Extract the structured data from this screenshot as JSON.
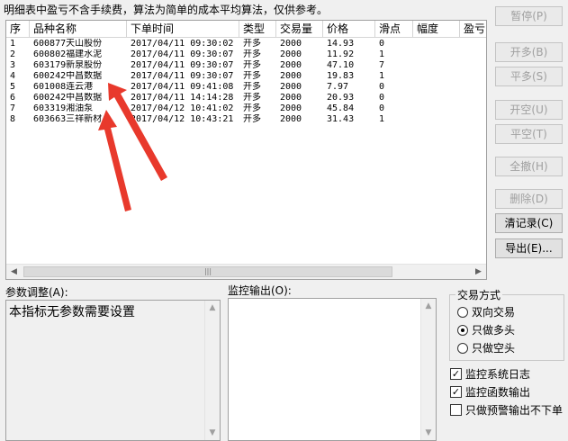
{
  "note": "明细表中盈亏不含手续费，算法为简单的成本平均算法，仅供参考。",
  "table": {
    "columns": [
      "序",
      "品种名称",
      "下单时间",
      "类型",
      "交易量",
      "价格",
      "滑点",
      "幅度",
      "盈亏"
    ],
    "rows": [
      {
        "seq": "1",
        "name": "600877天山股份",
        "time": "2017/04/11  09:30:02",
        "type": "开多",
        "qty": "2000",
        "price": "14.93",
        "slip": "0",
        "amp": "",
        "pnl": ""
      },
      {
        "seq": "2",
        "name": "600802福建水泥",
        "time": "2017/04/11  09:30:07",
        "type": "开多",
        "qty": "2000",
        "price": "11.92",
        "slip": "1",
        "amp": "",
        "pnl": ""
      },
      {
        "seq": "3",
        "name": "603179新泉股份",
        "time": "2017/04/11  09:30:07",
        "type": "开多",
        "qty": "2000",
        "price": "47.10",
        "slip": "7",
        "amp": "",
        "pnl": ""
      },
      {
        "seq": "4",
        "name": "600242中昌数据",
        "time": "2017/04/11  09:30:07",
        "type": "开多",
        "qty": "2000",
        "price": "19.83",
        "slip": "1",
        "amp": "",
        "pnl": ""
      },
      {
        "seq": "5",
        "name": "601008连云港",
        "time": "2017/04/11  09:41:08",
        "type": "开多",
        "qty": "2000",
        "price": "7.97",
        "slip": "0",
        "amp": "",
        "pnl": ""
      },
      {
        "seq": "6",
        "name": "600242中昌数据",
        "time": "2017/04/11  14:14:28",
        "type": "开多",
        "qty": "2000",
        "price": "20.93",
        "slip": "0",
        "amp": "",
        "pnl": ""
      },
      {
        "seq": "7",
        "name": "603319湘油泵",
        "time": "2017/04/12  10:41:02",
        "type": "开多",
        "qty": "2000",
        "price": "45.84",
        "slip": "0",
        "amp": "",
        "pnl": ""
      },
      {
        "seq": "8",
        "name": "603663三祥新材",
        "time": "2017/04/12  10:43:21",
        "type": "开多",
        "qty": "2000",
        "price": "31.43",
        "slip": "1",
        "amp": "",
        "pnl": ""
      }
    ]
  },
  "buttons": {
    "pause": "暂停(P)",
    "open_long": "开多(B)",
    "close_long": "平多(S)",
    "open_short": "开空(U)",
    "close_short": "平空(T)",
    "cancel_all": "全撤(H)",
    "delete": "删除(D)",
    "clear_log": "清记录(C)",
    "export": "导出(E)..."
  },
  "params": {
    "label": "参数调整(A):",
    "text": "本指标无参数需要设置"
  },
  "monitor": {
    "label": "监控输出(O):"
  },
  "trade_mode": {
    "title": "交易方式",
    "options": [
      "双向交易",
      "只做多头",
      "只做空头"
    ],
    "selected": "只做多头"
  },
  "checkboxes": [
    {
      "label": "监控系统日志",
      "checked": true
    },
    {
      "label": "监控函数输出",
      "checked": true
    },
    {
      "label": "只做预警输出不下单",
      "checked": false
    }
  ],
  "colors": {
    "annotation_arrow": "#e8392c"
  }
}
